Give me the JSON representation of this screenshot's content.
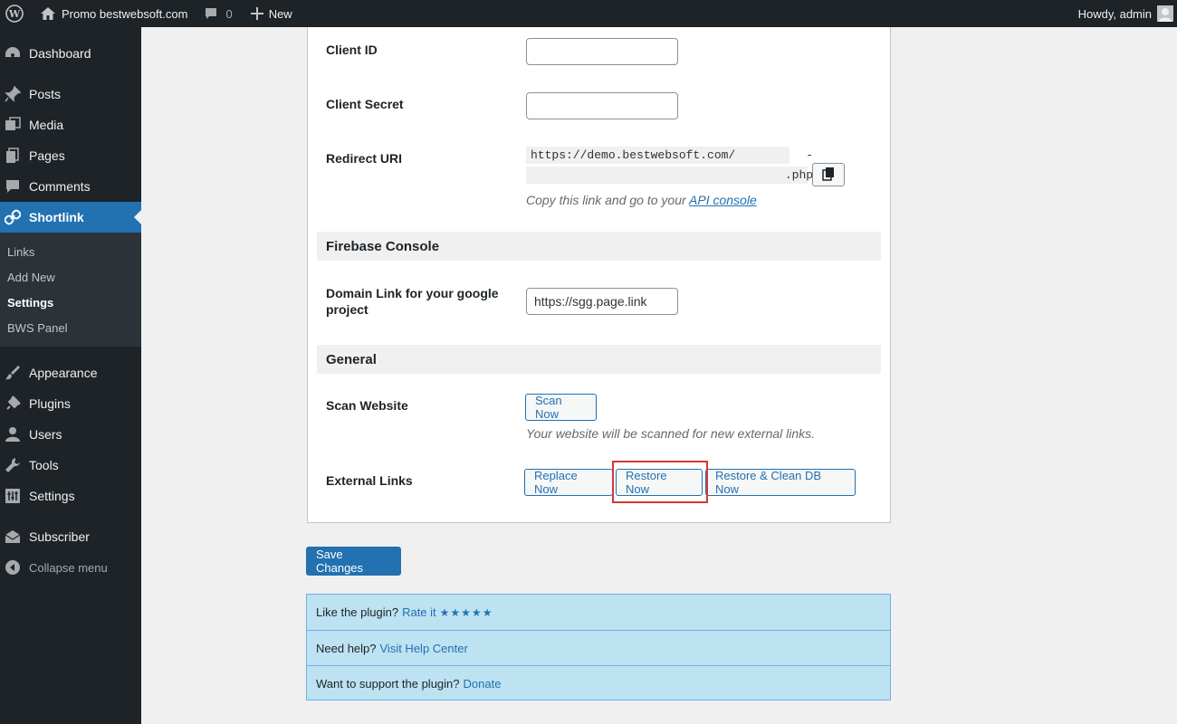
{
  "adminbar": {
    "wp_logo_icon": "wordpress-logo-icon",
    "site_name": "Promo bestwebsoft.com",
    "comments_count": "0",
    "new_label": "New",
    "greeting": "Howdy, admin"
  },
  "sidebar": {
    "items": [
      {
        "label": "Dashboard",
        "icon": "dashboard-icon"
      },
      {
        "label": "Posts",
        "icon": "pin-icon"
      },
      {
        "label": "Media",
        "icon": "media-icon"
      },
      {
        "label": "Pages",
        "icon": "pages-icon"
      },
      {
        "label": "Comments",
        "icon": "comment-icon"
      },
      {
        "label": "Shortlink",
        "icon": "link-icon"
      },
      {
        "label": "Appearance",
        "icon": "brush-icon"
      },
      {
        "label": "Plugins",
        "icon": "plugin-icon"
      },
      {
        "label": "Users",
        "icon": "user-icon"
      },
      {
        "label": "Tools",
        "icon": "wrench-icon"
      },
      {
        "label": "Settings",
        "icon": "settings-icon"
      },
      {
        "label": "Subscriber",
        "icon": "envelope-icon"
      }
    ],
    "submenu": [
      "Links",
      "Add New",
      "Settings",
      "BWS Panel"
    ],
    "collapse_label": "Collapse menu"
  },
  "form": {
    "client_id_label": "Client ID",
    "client_id_value": "",
    "client_secret_label": "Client Secret",
    "client_secret_value": "",
    "redirect_uri_label": "Redirect URI",
    "redirect_uri_line1": "https://demo.bestwebsoft.com/          -",
    "redirect_uri_line2": "                                    .php",
    "redirect_desc": "Copy this link and go to your",
    "api_console_link": "API console",
    "firebase_heading": "Firebase Console",
    "domain_link_label_line1": "Domain Link for your google",
    "domain_link_label_line2": "project",
    "domain_link_value": "https://sgg.page.link",
    "general_heading": "General",
    "scan_label": "Scan Website",
    "scan_button": "Scan Now",
    "scan_desc": "Your website will be scanned for new external links.",
    "external_links_label": "External Links",
    "replace_button": "Replace Now",
    "restore_button": "Restore Now",
    "restore_clean_button": "Restore & Clean DB Now"
  },
  "save_button": "Save Changes",
  "info": {
    "like_text": "Like the plugin?",
    "rate_link": "Rate it",
    "stars": "★★★★★",
    "help_text": "Need help?",
    "help_link": "Visit Help Center",
    "support_text": "Want to support the plugin?",
    "donate_link": "Donate"
  }
}
